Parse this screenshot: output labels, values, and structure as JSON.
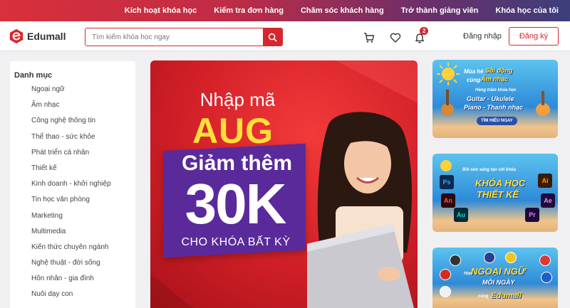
{
  "topnav": {
    "items": [
      "Kích hoạt khóa học",
      "Kiểm tra đơn hàng",
      "Chăm sóc khách hàng",
      "Trở thành giảng viên",
      "Khóa học của tôi"
    ]
  },
  "header": {
    "logo_text": "Edumall",
    "search_placeholder": "Tìm kiếm khóa học ngay",
    "notification_count": "2",
    "login": "Đăng nhập",
    "signup": "Đăng ký"
  },
  "sidebar": {
    "title": "Danh mục",
    "items": [
      "Ngoại ngữ",
      "Âm nhạc",
      "Công nghệ thông tin",
      "Thể thao - sức khỏe",
      "Phát triển cá nhân",
      "Thiết kế",
      "Kinh doanh - khởi nghiệp",
      "Tin học văn phòng",
      "Marketing",
      "Multimedia",
      "Kiến thức chuyên ngành",
      "Nghệ thuật - đời sống",
      "Hôn nhân - gia đình",
      "Nuôi dạy con"
    ]
  },
  "banner": {
    "line1": "Nhập mã",
    "code": "AUG",
    "line2": "Giảm thêm",
    "amount": "30K",
    "line3": "CHO KHÓA BẤT KỲ"
  },
  "promo1": {
    "heading_a": "Mùa hè",
    "heading_b": "Sôi động",
    "heading_c": "cùng",
    "heading_d": "Âm nhạc",
    "sub": "Hàng trăm khóa học",
    "line1": "Guitar - Ukulele",
    "line2": "Piano - Thanh nhạc",
    "button": "TÌM HIỂU NGAY"
  },
  "promo2": {
    "tagline": "Bồi sức sáng tạo với khóa",
    "line1": "KHÓA HỌC",
    "line2": "THIẾT KẾ",
    "apps": [
      "Ps",
      "Ai",
      "Ae",
      "An",
      "Au",
      "Pr"
    ]
  },
  "promo3": {
    "prefix": "Học",
    "line1": "NGOẠI NGỮ",
    "line2": "MỖI NGÀY",
    "brand_prefix": "cùng",
    "brand": "Edumall"
  },
  "colors": {
    "brand_red": "#d7262d",
    "topbar_gradient_end": "#3c3f7c",
    "banner_purple": "#5a2a9b",
    "banner_yellow": "#ffe03a"
  }
}
